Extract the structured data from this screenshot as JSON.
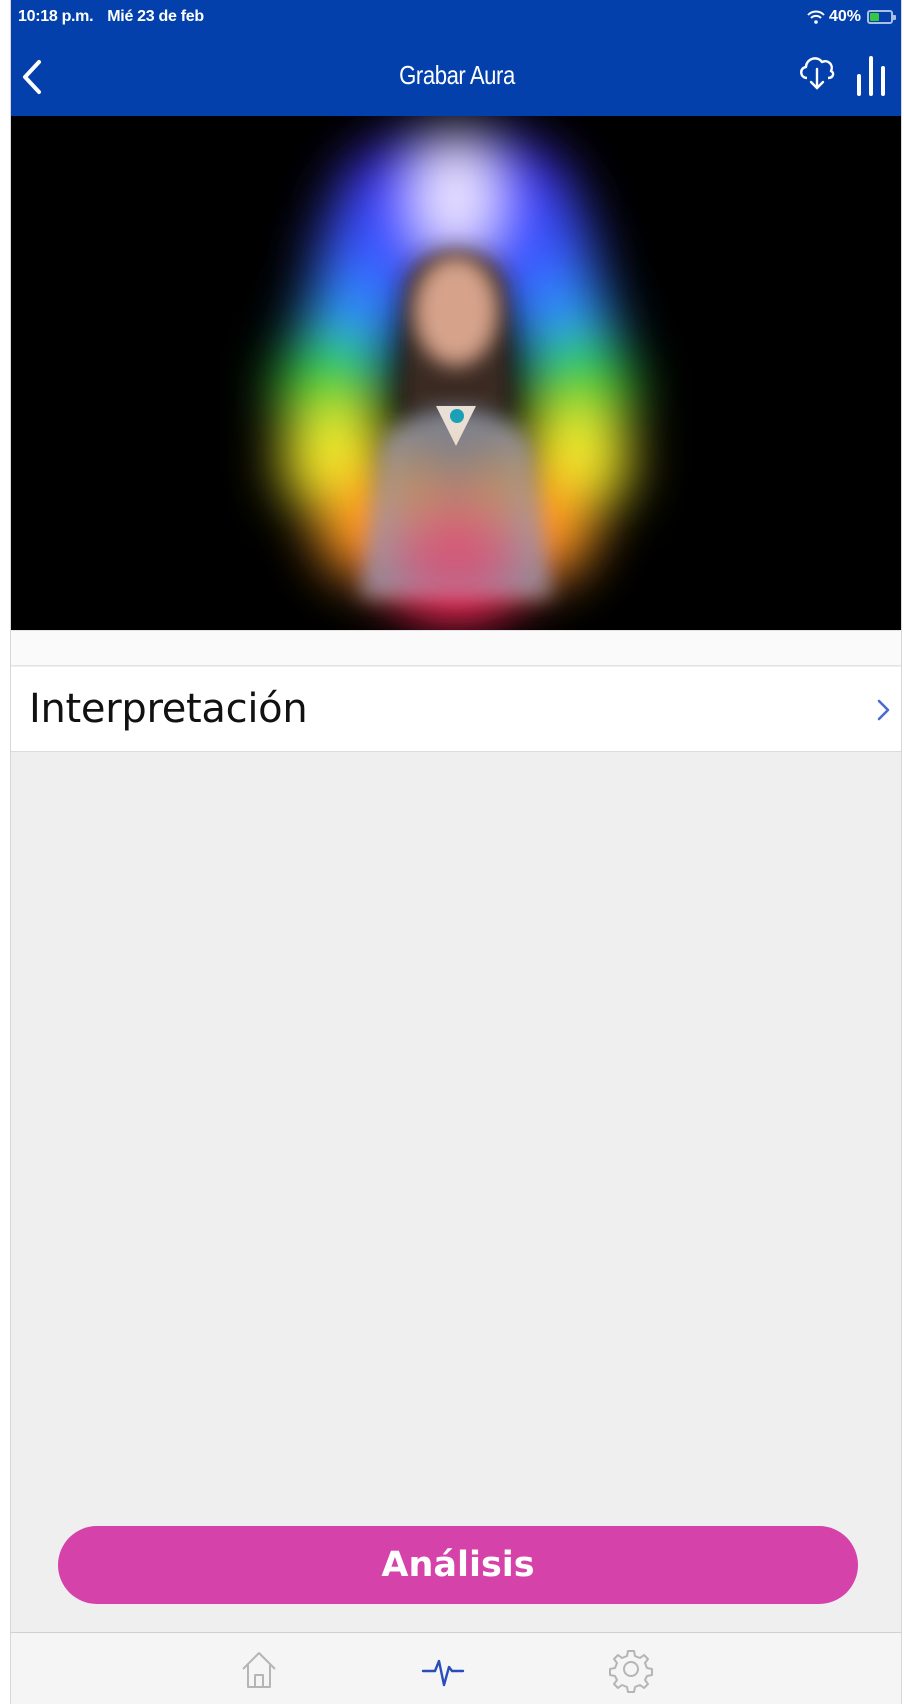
{
  "status_bar": {
    "time": "10:18 p.m.",
    "date": "Mié 23 de feb",
    "battery": "40%"
  },
  "header": {
    "title": "Grabar Aura",
    "back_icon": "chevron-left-icon",
    "actions": [
      "cloud-download-icon",
      "equalizer-bars-icon"
    ]
  },
  "aura_preview": {
    "colors": [
      "#ffffff",
      "#4b3dff",
      "#2f8fff",
      "#32cf3a",
      "#f1ea2c",
      "#ff9722",
      "#ff2a5a"
    ]
  },
  "menu": {
    "interpretation_label": "Interpretación"
  },
  "analysis_button": {
    "label": "Análisis"
  },
  "tab_bar": {
    "tabs": [
      {
        "icon": "home-icon",
        "active": false
      },
      {
        "icon": "heartbeat-icon",
        "active": true
      },
      {
        "icon": "gear-icon",
        "active": false
      }
    ]
  },
  "colors": {
    "header_bg": "#0340ac",
    "accent_button": "#d542aa",
    "active_tab": "#2a4dbb"
  }
}
